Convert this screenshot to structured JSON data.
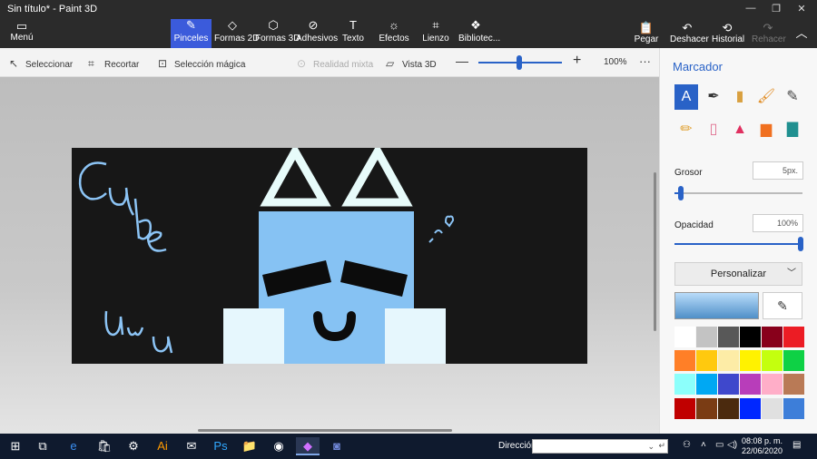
{
  "window": {
    "title": "Sin título* - Paint 3D",
    "minimize": "—",
    "restore": "❐",
    "close": "✕"
  },
  "menu": {
    "label": "Menú",
    "icon": "folder-icon"
  },
  "tools": [
    {
      "label": "Pinceles",
      "icon": "brush-icon",
      "active": true
    },
    {
      "label": "Formas 2D",
      "icon": "shapes-2d-icon"
    },
    {
      "label": "Formas 3D",
      "icon": "cube-icon"
    },
    {
      "label": "Adhesivos",
      "icon": "sticker-icon"
    },
    {
      "label": "Texto",
      "icon": "text-icon"
    },
    {
      "label": "Efectos",
      "icon": "effects-icon"
    },
    {
      "label": "Lienzo",
      "icon": "canvas-icon"
    },
    {
      "label": "Bibliotec...",
      "icon": "library-icon"
    }
  ],
  "right_tools": [
    {
      "label": "Pegar",
      "icon": "paste-icon"
    },
    {
      "label": "Deshacer",
      "icon": "undo-icon"
    },
    {
      "label": "Historial",
      "icon": "history-icon"
    },
    {
      "label": "Rehacer",
      "icon": "redo-icon",
      "disabled": true
    }
  ],
  "subbar": {
    "select": "Seleccionar",
    "crop": "Recortar",
    "magic_select": "Selección mágica",
    "mixed_reality": "Realidad mixta",
    "view_3d": "Vista 3D",
    "zoom_out": "—",
    "zoom_in": "+",
    "zoom": "100%",
    "more": "···"
  },
  "panel": {
    "title": "Marcador",
    "thickness_label": "Grosor",
    "thickness_value": "5px.",
    "thickness_level": 0.05,
    "opacity_label": "Opacidad",
    "opacity_value": "100%",
    "opacity_level": 1.0,
    "customize": "Personalizar",
    "brushes": [
      {
        "name": "marker-brush",
        "glyph": "A",
        "selected": true
      },
      {
        "name": "calligraphy-pen",
        "glyph": "✒"
      },
      {
        "name": "oil-brush",
        "glyph": "▮"
      },
      {
        "name": "watercolor-brush",
        "glyph": "🖌"
      },
      {
        "name": "pixel-pen",
        "glyph": "✎"
      },
      {
        "name": "pencil",
        "glyph": "✏"
      },
      {
        "name": "eraser",
        "glyph": "▯"
      },
      {
        "name": "crayon",
        "glyph": "▲"
      },
      {
        "name": "spray-can",
        "glyph": "▆"
      },
      {
        "name": "fill-bucket",
        "glyph": "▇"
      }
    ],
    "colors": [
      "#ffffff",
      "#c3c3c3",
      "#585858",
      "#000000",
      "#88001b",
      "#ec1c24",
      "#ff7f27",
      "#ffc90e",
      "#fdeca6",
      "#fff200",
      "#c4ff0e",
      "#0ed145",
      "#8cfffb",
      "#00a8f3",
      "#3f48cc",
      "#b83dba",
      "#ffaec8",
      "#b97a56",
      "#c00000",
      "#7a3c14",
      "#4b2a0e",
      "#0027ff",
      "#e0e0e0",
      "#3d7ed9"
    ]
  },
  "taskbar": {
    "search_label": "Dirección",
    "search_value": "",
    "time": "08:08 p. m.",
    "date": "22/06/2020",
    "icons": [
      "windows-icon",
      "task-view-icon",
      "edge-icon",
      "store-icon",
      "settings-icon",
      "illustrator-icon",
      "mail-icon",
      "photoshop-icon",
      "file-explorer-icon",
      "chrome-icon",
      "paint3d-icon",
      "discord-icon"
    ]
  }
}
